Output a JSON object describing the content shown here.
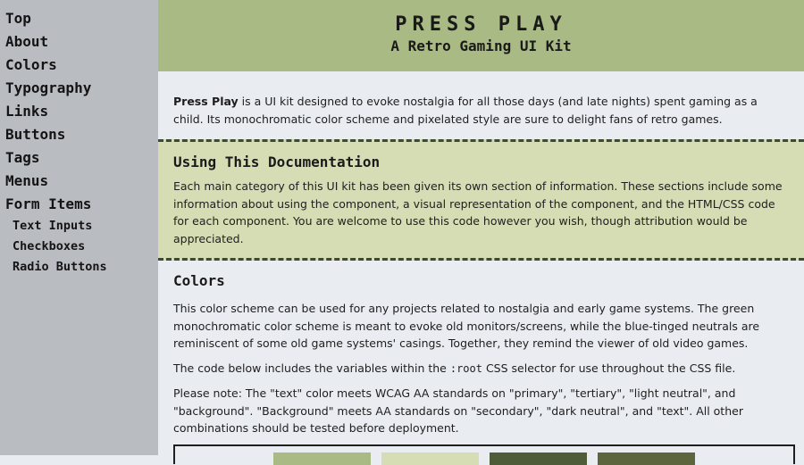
{
  "sidebar": {
    "items": [
      {
        "label": "Top"
      },
      {
        "label": "About"
      },
      {
        "label": "Colors"
      },
      {
        "label": "Typography"
      },
      {
        "label": "Links"
      },
      {
        "label": "Buttons"
      },
      {
        "label": "Tags"
      },
      {
        "label": "Menus"
      },
      {
        "label": "Form Items"
      }
    ],
    "subitems": [
      {
        "label": "Text Inputs"
      },
      {
        "label": "Checkboxes"
      },
      {
        "label": "Radio Buttons"
      }
    ]
  },
  "header": {
    "title": "PRESS PLAY",
    "subtitle": "A Retro Gaming UI Kit"
  },
  "intro": {
    "bold": "Press Play",
    "text": " is a UI kit designed to evoke nostalgia for all those days (and late nights) spent gaming as a child. Its monochromatic color scheme and pixelated style are sure to delight fans of retro games."
  },
  "docs": {
    "heading": "Using This Documentation",
    "text": "Each main category of this UI kit has been given its own section of information. These sections include some information about using the component, a visual representation of the component, and the HTML/CSS code for each component. You are welcome to use this code however you wish, though attribution would be appreciated."
  },
  "colors": {
    "heading": "Colors",
    "p1": "This color scheme can be used for any projects related to nostalgia and early game systems. The green monochromatic color scheme is meant to evoke old monitors/screens, while the blue-tinged neutrals are reminiscent of some old game systems' casings. Together, they remind the viewer of old video games.",
    "p2_before": "The code below includes the variables within the ",
    "p2_code": ":root",
    "p2_after": " CSS selector for use throughout the CSS file.",
    "p3": "Please note: The \"text\" color meets WCAG AA standards on \"primary\", \"tertiary\", \"light neutral\", and \"background\". \"Background\" meets AA standards on \"secondary\", \"dark neutral\", and \"text\". All other combinations should be tested before deployment."
  },
  "swatches": {
    "colors": [
      "#a9ba84",
      "#d6dcb4",
      "#4f5c3a",
      "#5c653e"
    ]
  }
}
